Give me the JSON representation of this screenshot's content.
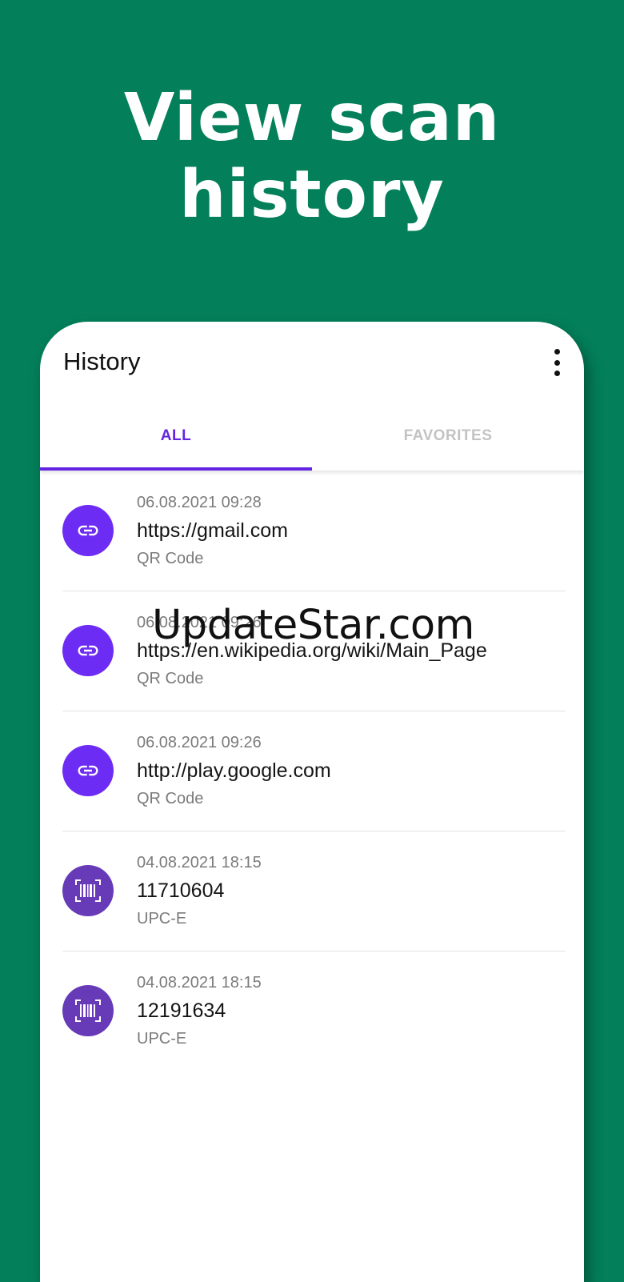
{
  "headline": {
    "line1": "View scan",
    "line2": "history"
  },
  "app": {
    "title": "History",
    "menu_icon": "more-vert-icon",
    "tabs": [
      {
        "label": "ALL",
        "active": true
      },
      {
        "label": "FAVORITES",
        "active": false
      }
    ],
    "history": [
      {
        "date": "06.08.2021 09:28",
        "value": "https://gmail.com",
        "type": "QR Code",
        "icon": "link-icon"
      },
      {
        "date": "06.08.2021 09:26",
        "value": "https://en.wikipedia.org/wiki/Main_Page",
        "type": "QR Code",
        "icon": "link-icon"
      },
      {
        "date": "06.08.2021 09:26",
        "value": "http://play.google.com",
        "type": "QR Code",
        "icon": "link-icon"
      },
      {
        "date": "04.08.2021 18:15",
        "value": "11710604",
        "type": "UPC-E",
        "icon": "barcode-icon"
      },
      {
        "date": "04.08.2021 18:15",
        "value": "12191634",
        "type": "UPC-E",
        "icon": "barcode-icon"
      }
    ]
  },
  "watermark": "UpdateStar.com",
  "colors": {
    "background": "#037f5a",
    "accent": "#6424e4",
    "link_icon_bg": "#6d2cf4",
    "barcode_icon_bg": "#673ab7"
  }
}
